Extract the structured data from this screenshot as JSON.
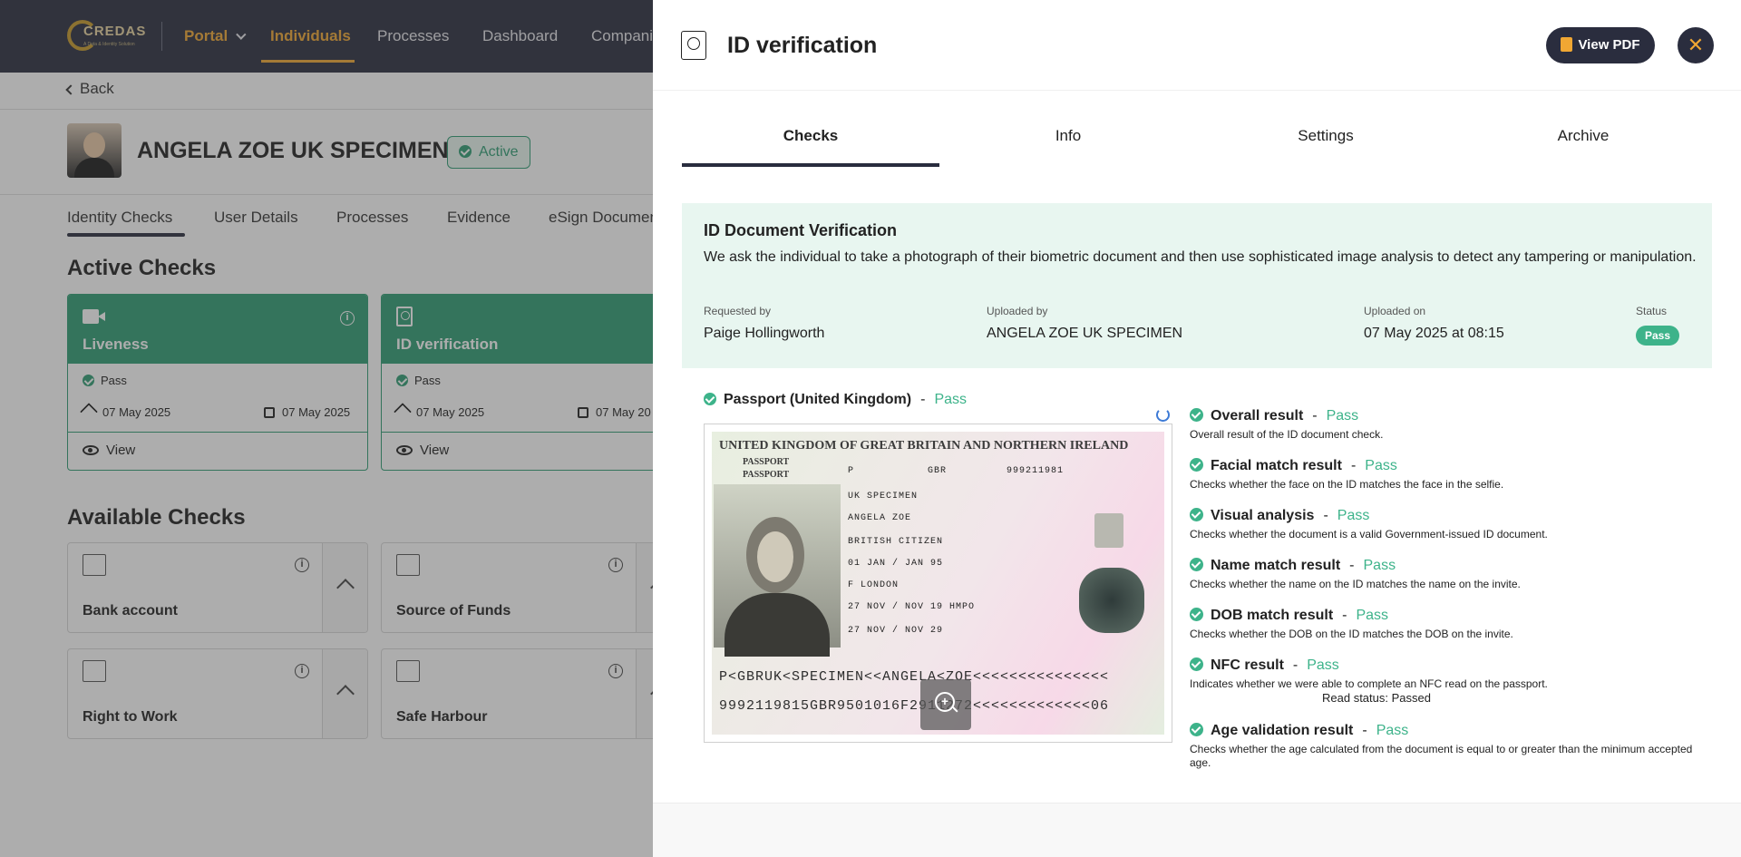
{
  "topbar": {
    "logo_text": "CREDAS",
    "logo_sub": "A Data & Identity Solution",
    "nav": [
      {
        "label": "Portal"
      },
      {
        "label": "Individuals"
      },
      {
        "label": "Processes"
      },
      {
        "label": "Dashboard"
      },
      {
        "label": "Compani"
      }
    ]
  },
  "page": {
    "back_label": "Back",
    "person_name": "ANGELA ZOE UK SPECIMEN",
    "status_badge": "Active",
    "subtabs": [
      "Identity Checks",
      "User Details",
      "Processes",
      "Evidence",
      "eSign Documen"
    ],
    "active_checks_title": "Active Checks",
    "active_checks": [
      {
        "title": "Liveness",
        "icon": "video-camera-icon",
        "result": "Pass",
        "sent": "07 May 2025",
        "date": "07 May 2025",
        "view": "View"
      },
      {
        "title": "ID verification",
        "icon": "passport-icon",
        "result": "Pass",
        "sent": "07 May 2025",
        "date": "07 May 20",
        "view": "View"
      }
    ],
    "available_checks_title": "Available Checks",
    "available_checks": [
      {
        "title": "Bank account",
        "icon": "bank-icon"
      },
      {
        "title": "Source of Funds",
        "icon": "money-icon"
      },
      {
        "title": "Right to Work",
        "icon": "worker-icon"
      },
      {
        "title": "Safe Harbour",
        "icon": "harbour-icon"
      }
    ]
  },
  "drawer": {
    "title": "ID verification",
    "view_pdf_label": "View PDF",
    "close_label": "✕",
    "tabs": [
      "Checks",
      "Info",
      "Settings",
      "Archive"
    ],
    "active_tab": "Checks",
    "verification": {
      "title": "ID Document Verification",
      "description": "We ask the individual to take a photograph of their biometric document and then use sophisticated image analysis to detect any tampering or manipulation.",
      "requested_by_label": "Requested by",
      "requested_by": "Paige Hollingworth",
      "uploaded_by_label": "Uploaded by",
      "uploaded_by": "ANGELA ZOE UK SPECIMEN",
      "uploaded_on_label": "Uploaded on",
      "uploaded_on": "07 May 2025 at 08:15",
      "status_label": "Status",
      "status": "Pass"
    },
    "document": {
      "name": "Passport (United Kingdom)",
      "dash": "-",
      "result": "Pass"
    },
    "passport_image": {
      "header": "UNITED KINGDOM OF GREAT BRITAIN AND NORTHERN IRELAND",
      "label1": "PASSPORT",
      "label2": "PASSPORT",
      "type": "P",
      "code": "GBR",
      "number": "999211981",
      "surname": "UK SPECIMEN",
      "given_names": "ANGELA ZOE",
      "nationality": "BRITISH CITIZEN",
      "dob": "01 JAN / JAN 95",
      "sex_place": "F      LONDON",
      "issue": "27 NOV / NOV 19  HMPO",
      "expiry": "27 NOV / NOV 29",
      "mrz1": "P<GBRUK<SPECIMEN<<ANGELA<ZOE<<<<<<<<<<<<<<<",
      "mrz2": "9992119815GBR9501016F2911272<<<<<<<<<<<<<06"
    },
    "results": [
      {
        "title": "Overall result",
        "result": "Pass",
        "description": "Overall result of the ID document check."
      },
      {
        "title": "Facial match result",
        "result": "Pass",
        "description": "Checks whether the face on the ID matches the face in the selfie."
      },
      {
        "title": "Visual analysis",
        "result": "Pass",
        "description": "Checks whether the document is a valid Government-issued ID document."
      },
      {
        "title": "Name match result",
        "result": "Pass",
        "description": "Checks whether the name on the ID matches the name on the invite."
      },
      {
        "title": "DOB match result",
        "result": "Pass",
        "description": "Checks whether the DOB on the ID matches the DOB on the invite."
      },
      {
        "title": "NFC result",
        "result": "Pass",
        "description": "Indicates whether we were able to complete an NFC read on the passport.",
        "extra": "Read status: Passed"
      },
      {
        "title": "Age validation result",
        "result": "Pass",
        "description": "Checks whether the age calculated from the document is equal to or greater than the minimum accepted age."
      }
    ],
    "dash": "-"
  },
  "colors": {
    "navy": "#2a2d3e",
    "accent_orange": "#f0a733",
    "pass_green": "#3db38a",
    "card_green": "#2f9e74",
    "verif_bg": "#e8f6f0"
  }
}
